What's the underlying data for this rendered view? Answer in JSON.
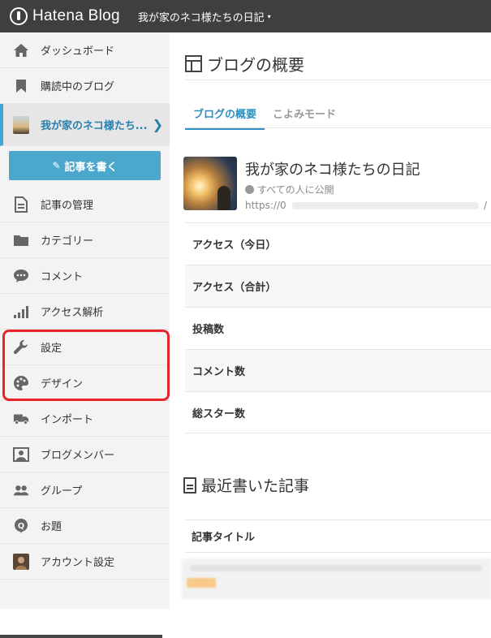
{
  "header": {
    "logo_text": "Hatena Blog",
    "blog_selector": "我が家のネコ様たちの日記",
    "caret": "▾"
  },
  "sidebar": {
    "items": [
      {
        "label": "ダッシュボード",
        "icon": "home-icon"
      },
      {
        "label": "購読中のブログ",
        "icon": "bookmark-icon"
      },
      {
        "label": "我が家のネコ様たち...",
        "icon": "blog-thumbnail"
      },
      {
        "label": "記事の管理",
        "icon": "document-icon"
      },
      {
        "label": "カテゴリー",
        "icon": "folder-icon"
      },
      {
        "label": "コメント",
        "icon": "comment-icon"
      },
      {
        "label": "アクセス解析",
        "icon": "signal-bars-icon"
      },
      {
        "label": "設定",
        "icon": "wrench-icon"
      },
      {
        "label": "デザイン",
        "icon": "palette-icon"
      },
      {
        "label": "インポート",
        "icon": "truck-icon"
      },
      {
        "label": "ブログメンバー",
        "icon": "member-card-icon"
      },
      {
        "label": "グループ",
        "icon": "group-icon"
      },
      {
        "label": "お題",
        "icon": "q-bubble-icon"
      },
      {
        "label": "アカウント設定",
        "icon": "user-avatar"
      }
    ],
    "write_button": "記事を書く",
    "current_chevron": "❯"
  },
  "main": {
    "title": "ブログの概要",
    "tabs": [
      {
        "label": "ブログの概要",
        "active": true
      },
      {
        "label": "こよみモード",
        "active": false
      }
    ],
    "blog": {
      "name": "我が家のネコ様たちの日記",
      "visibility": "すべての人に公開",
      "url_prefix": "https://0",
      "url_suffix": "/"
    },
    "stats": [
      "アクセス（今日）",
      "アクセス（合計）",
      "投稿数",
      "コメント数",
      "総スター数"
    ],
    "recent_title": "最近書いた記事",
    "column_header": "記事タイトル"
  },
  "colors": {
    "topbar": "#3d3f41",
    "accent": "#4ba7cc",
    "highlight": "#e8242a"
  }
}
